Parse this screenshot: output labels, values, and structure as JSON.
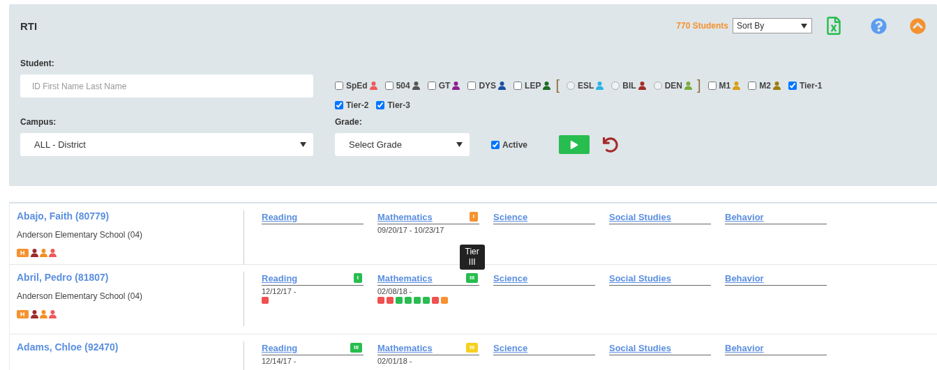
{
  "header": {
    "title": "RTI",
    "count": "770 Students",
    "sort": {
      "value": "Sort By"
    }
  },
  "filters": {
    "student": {
      "label": "Student:",
      "placeholder": "ID First Name Last Name"
    },
    "campus": {
      "label": "Campus:",
      "value": "ALL - District"
    },
    "grade": {
      "label": "Grade:",
      "value": "Select Grade"
    },
    "active": {
      "label": "Active",
      "checked": true
    },
    "flags": [
      {
        "kind": "checkbox",
        "label": "SpEd",
        "checked": false,
        "color": "#f05a5a"
      },
      {
        "kind": "checkbox",
        "label": "504",
        "checked": false,
        "color": "#555555"
      },
      {
        "kind": "checkbox",
        "label": "GT",
        "checked": false,
        "color": "#8e1f8e"
      },
      {
        "kind": "checkbox",
        "label": "DYS",
        "checked": false,
        "color": "#1c4fa3"
      },
      {
        "kind": "checkbox",
        "label": "LEP",
        "checked": false,
        "color": "#1f6b24"
      },
      {
        "kind": "bracket",
        "label": "["
      },
      {
        "kind": "radio",
        "label": "ESL",
        "selected": false,
        "color": "#2bb3e6"
      },
      {
        "kind": "radio",
        "label": "BIL",
        "selected": false,
        "color": "#a52a2a"
      },
      {
        "kind": "radio",
        "label": "DEN",
        "selected": false,
        "color": "#7aab3c"
      },
      {
        "kind": "bracket",
        "label": "]"
      },
      {
        "kind": "checkbox",
        "label": "M1",
        "checked": false,
        "color": "#d9a010"
      },
      {
        "kind": "checkbox",
        "label": "M2",
        "checked": false,
        "color": "#9e7d0c"
      },
      {
        "kind": "checkbox",
        "label": "Tier-1",
        "checked": true
      },
      {
        "kind": "checkbox",
        "label": "Tier-2",
        "checked": true
      },
      {
        "kind": "checkbox",
        "label": "Tier-3",
        "checked": true
      }
    ]
  },
  "students": [
    {
      "name": "Abajo, Faith (80779)",
      "school": "Anderson Elementary School (04)",
      "tag": "H",
      "markers": [
        {
          "color": "#9e2a2b"
        },
        {
          "color": "#f39020"
        },
        {
          "color": "#f05a5a"
        }
      ],
      "subjects": [
        {
          "label": "Reading"
        },
        {
          "label": "Mathematics",
          "tier": {
            "label": "I",
            "color": "#f5922f"
          },
          "dates": "09/20/17 - 10/23/17"
        },
        {
          "label": "Science"
        },
        {
          "label": "Social Studies"
        },
        {
          "label": "Behavior"
        }
      ]
    },
    {
      "name": "Abril, Pedro (81807)",
      "school": "Anderson Elementary School (04)",
      "tag": "H",
      "markers": [
        {
          "color": "#9e2a2b"
        },
        {
          "color": "#f39020"
        },
        {
          "color": "#f05a5a"
        }
      ],
      "subjects": [
        {
          "label": "Reading",
          "tier": {
            "label": "I",
            "color": "#27bd4f"
          },
          "dates": "12/12/17 -",
          "checks": [
            {
              "color": "#f05050"
            }
          ]
        },
        {
          "label": "Mathematics",
          "tier": {
            "label": "III",
            "color": "#27bd4f"
          },
          "tooltip": "Tier III",
          "dates": "02/08/18 -",
          "checks": [
            {
              "color": "#f05050"
            },
            {
              "color": "#f05050"
            },
            {
              "color": "#27bd4f"
            },
            {
              "color": "#27bd4f"
            },
            {
              "color": "#27bd4f"
            },
            {
              "color": "#27bd4f"
            },
            {
              "color": "#f05050"
            },
            {
              "color": "#f5922f"
            }
          ]
        },
        {
          "label": "Science"
        },
        {
          "label": "Social Studies"
        },
        {
          "label": "Behavior"
        }
      ]
    },
    {
      "name": "Adams, Chloe (92470)",
      "subjects": [
        {
          "label": "Reading",
          "tier": {
            "label": "III",
            "color": "#27bd4f"
          },
          "dates": "12/14/17 -"
        },
        {
          "label": "Mathematics",
          "tier": {
            "label": "III",
            "color": "#f5d020"
          },
          "dates": "02/01/18 -"
        },
        {
          "label": "Science"
        },
        {
          "label": "Social Studies"
        },
        {
          "label": "Behavior"
        }
      ]
    }
  ]
}
